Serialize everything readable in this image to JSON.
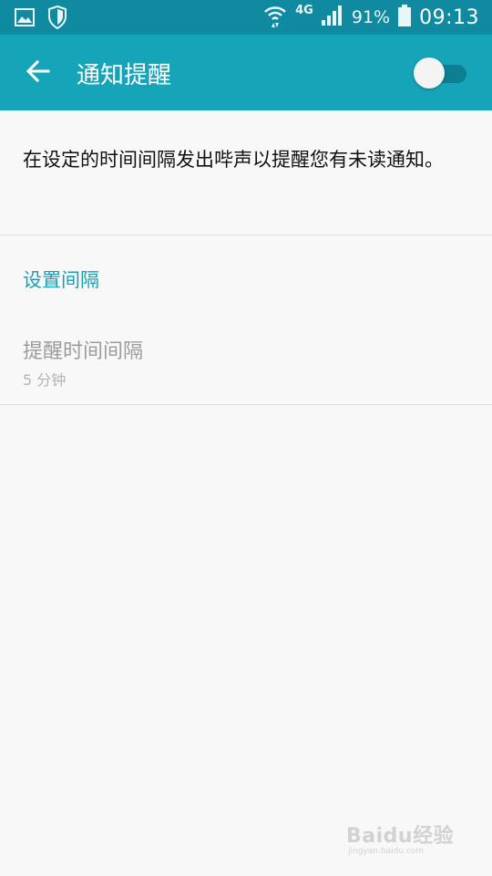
{
  "status_bar": {
    "network_label": "4G",
    "battery_percent": "91%",
    "time": "09:13",
    "icons": [
      "gallery-icon",
      "shield-icon",
      "wifi-icon",
      "signal-icon",
      "battery-icon"
    ]
  },
  "app_bar": {
    "title": "通知提醒",
    "back_icon": "arrow-left-icon",
    "toggle_state": "off"
  },
  "description": "在设定的时间间隔发出哔声以提醒您有未读通知。",
  "section_header": "设置间隔",
  "setting": {
    "title": "提醒时间间隔",
    "summary": "5 分钟"
  },
  "watermark": {
    "brand": "Baidu经验",
    "url": "jingyan.baidu.com"
  },
  "colors": {
    "status_bar": "#0f8aa0",
    "app_bar": "#16a5b8",
    "accent": "#1a9fb2",
    "background": "#f8f8f8"
  }
}
